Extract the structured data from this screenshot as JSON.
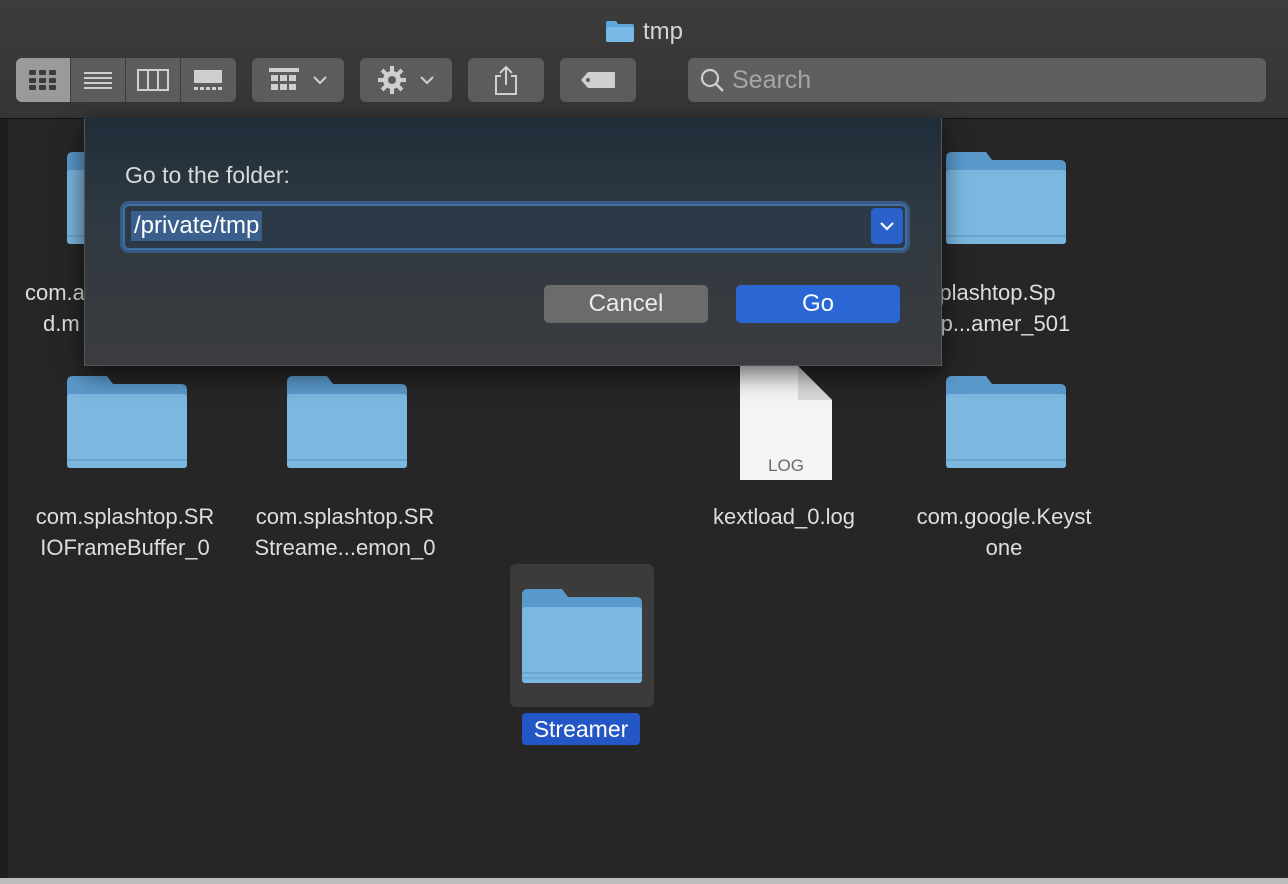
{
  "window": {
    "title": "tmp"
  },
  "toolbar": {
    "view_modes": [
      "icon-view-icon",
      "list-view-icon",
      "column-view-icon",
      "gallery-view-icon"
    ],
    "active_view": "icon-view-icon",
    "search_placeholder": "Search"
  },
  "dialog": {
    "prompt": "Go to the folder:",
    "path_value": "/private/tmp",
    "cancel_label": "Cancel",
    "go_label": "Go"
  },
  "items": [
    {
      "line1": "com.a",
      "line2": "d.m",
      "kind": "folder"
    },
    {
      "line1": "n.splashtop.Sp",
      "line2": "ntop...amer_501",
      "kind": "folder"
    },
    {
      "line1": "com.splashtop.SR",
      "line2": "IOFrameBuffer_0",
      "kind": "folder"
    },
    {
      "line1": "com.splashtop.SR",
      "line2": "Streame...emon_0",
      "kind": "folder"
    },
    {
      "line1": "kextload_0.log",
      "line2": "",
      "kind": "log",
      "badge": "LOG"
    },
    {
      "line1": "com.google.Keyst",
      "line2": "one",
      "kind": "folder"
    },
    {
      "line1": "Streamer",
      "line2": "",
      "kind": "folder",
      "selected": true
    }
  ],
  "colors": {
    "folder_light": "#7cb7e0",
    "folder_dark": "#5a9acb",
    "accent": "#2a66d4",
    "selection": "#2457c5"
  }
}
